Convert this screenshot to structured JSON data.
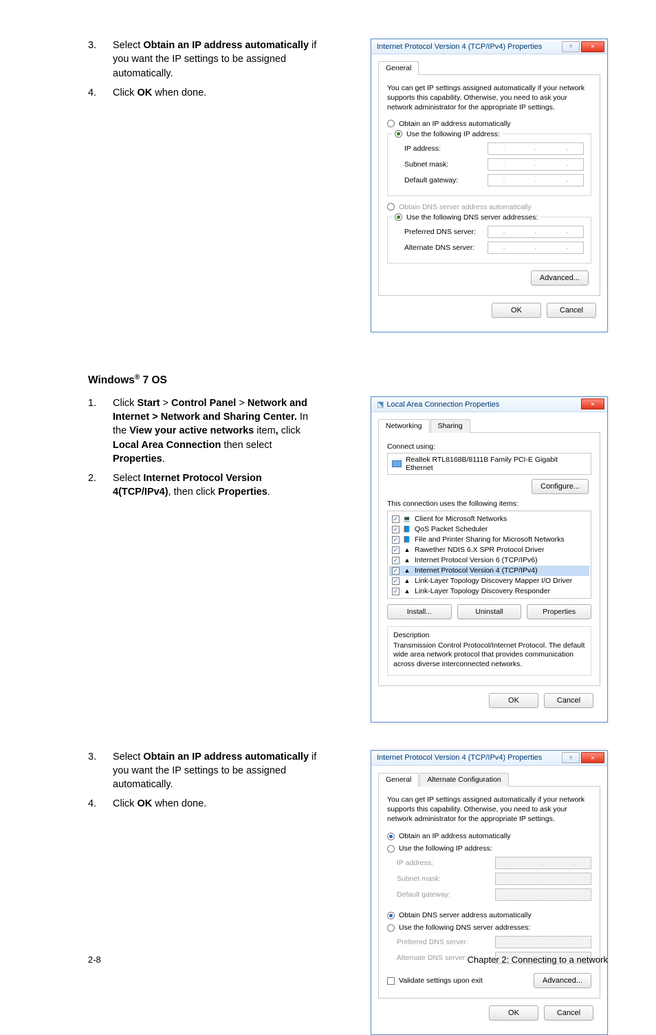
{
  "block1": {
    "steps": [
      {
        "num": "3.",
        "pre": "Select ",
        "b": "Obtain an IP address automatically",
        "post": " if you want the IP settings to be assigned automatically."
      },
      {
        "num": "4.",
        "pre": "Click ",
        "b": "OK",
        "post": " when done."
      }
    ]
  },
  "dlg1": {
    "title": "Internet Protocol Version 4 (TCP/IPv4) Properties",
    "tab": "General",
    "desc": "You can get IP settings assigned automatically if your network supports this capability. Otherwise, you need to ask your network administrator for the appropriate IP settings.",
    "r1": "Obtain an IP address automatically",
    "r2": "Use the following IP address:",
    "f_ip": "IP address:",
    "f_mask": "Subnet mask:",
    "f_gw": "Default gateway:",
    "r3": "Obtain DNS server address automatically",
    "r4": "Use the following DNS server addresses:",
    "f_dns1": "Preferred DNS server:",
    "f_dns2": "Alternate DNS server:",
    "adv": "Advanced...",
    "ok": "OK",
    "cancel": "Cancel"
  },
  "section2": {
    "pre": "Windows",
    "reg": "®",
    "post": " 7 OS"
  },
  "block2": {
    "steps": [
      {
        "num": "1.",
        "html": "Click <b>Start</b> > <b>Control Panel</b> > <b>Network and Internet > Network and Sharing Center.</b> In the <b>View your active networks</b> item<b>,</b> click <b>Local Area Connection</b> then select <b>Properties</b>."
      },
      {
        "num": "2.",
        "html": "Select <b>Internet Protocol Version 4(TCP/IPv4)</b>, then click <b>Properties</b>."
      }
    ]
  },
  "dlg2": {
    "title": "Local Area Connection Properties",
    "tab_net": "Networking",
    "tab_share": "Sharing",
    "conn_label": "Connect using:",
    "adapter": "Realtek RTL8168B/8111B Family PCI-E Gigabit Ethernet",
    "configure": "Configure...",
    "items_label": "This connection uses the following items:",
    "items": [
      {
        "t": "Client for Microsoft Networks",
        "i": "💻",
        "hl": false
      },
      {
        "t": "QoS Packet Scheduler",
        "i": "📘",
        "hl": false
      },
      {
        "t": "File and Printer Sharing for Microsoft Networks",
        "i": "📘",
        "hl": false
      },
      {
        "t": "Rawether NDIS 6.X SPR Protocol Driver",
        "i": "▲",
        "hl": false
      },
      {
        "t": "Internet Protocol Version 6 (TCP/IPv6)",
        "i": "▲",
        "hl": false
      },
      {
        "t": "Internet Protocol Version 4 (TCP/IPv4)",
        "i": "▲",
        "hl": true
      },
      {
        "t": "Link-Layer Topology Discovery Mapper I/O Driver",
        "i": "▲",
        "hl": false
      },
      {
        "t": "Link-Layer Topology Discovery Responder",
        "i": "▲",
        "hl": false
      }
    ],
    "install": "Install...",
    "uninstall": "Uninstall",
    "properties": "Properties",
    "desc_hd": "Description",
    "desc": "Transmission Control Protocol/Internet Protocol. The default wide area network protocol that provides communication across diverse interconnected networks.",
    "ok": "OK",
    "cancel": "Cancel"
  },
  "block3": {
    "steps": [
      {
        "num": "3.",
        "pre": "Select ",
        "b": "Obtain an IP address automatically",
        "post": " if you want the IP settings to be assigned automatically."
      },
      {
        "num": "4.",
        "pre": "Click ",
        "b": "OK",
        "post": " when done."
      }
    ]
  },
  "dlg3": {
    "title": "Internet Protocol Version 4 (TCP/IPv4) Properties",
    "tab_gen": "General",
    "tab_alt": "Alternate Configuration",
    "desc": "You can get IP settings assigned automatically if your network supports this capability. Otherwise, you need to ask your network administrator for the appropriate IP settings.",
    "r1": "Obtain an IP address automatically",
    "r2": "Use the following IP address:",
    "f_ip": "IP address:",
    "f_mask": "Subnet mask:",
    "f_gw": "Default gateway:",
    "r3": "Obtain DNS server address automatically",
    "r4": "Use the following DNS server addresses:",
    "f_dns1": "Preferred DNS server:",
    "f_dns2": "Alternate DNS server:",
    "validate": "Validate settings upon exit",
    "adv": "Advanced...",
    "ok": "OK",
    "cancel": "Cancel"
  },
  "footer": {
    "left": "2-8",
    "right": "Chapter 2: Connecting to a network"
  }
}
